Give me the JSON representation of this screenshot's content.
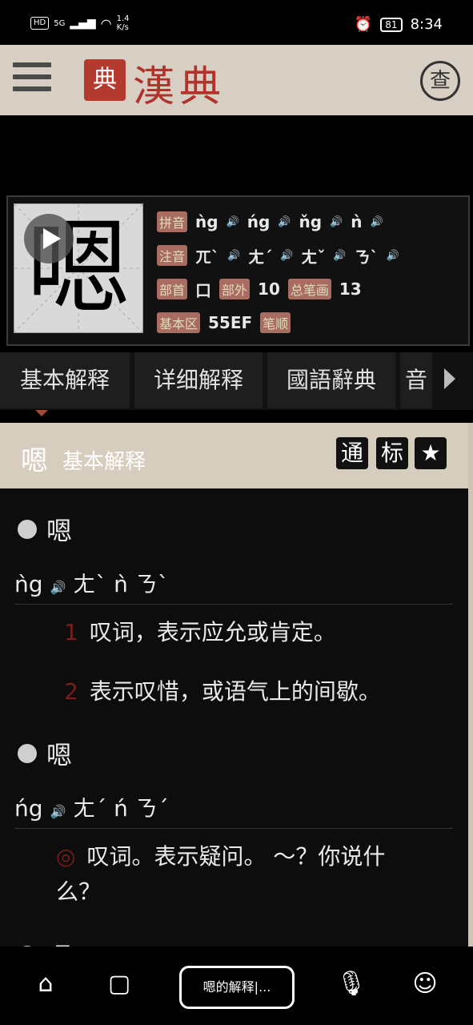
{
  "status": {
    "hd": "HD",
    "net": "5G",
    "speed_value": "1.4",
    "speed_unit": "K/s",
    "battery": "81",
    "time": "8:34"
  },
  "app": {
    "logo_seal": "典",
    "title": "漢典",
    "search_label": "查"
  },
  "card": {
    "character": "嗯",
    "pinyin_tag": "拼音",
    "pinyin": [
      "ǹg",
      "ńg",
      "ňg",
      "ǹ"
    ],
    "zhuyin_tag": "注音",
    "zhuyin": [
      "ㄫˋ",
      "ㄤˊ",
      "ㄤˇ",
      "ㄋˋ"
    ],
    "bushou_tag": "部首",
    "bushou": "口",
    "bushou_extra_tag": "部外",
    "bushou_extra": "10",
    "stroke_tag": "总笔画",
    "stroke": "13",
    "unicode_tag": "基本区",
    "unicode": "55EF",
    "order_tag": "笔顺"
  },
  "tabs": [
    "基本解释",
    "详细解释",
    "國語辭典",
    "音"
  ],
  "panel": {
    "head_char": "嗯",
    "head_title": "基本解释",
    "btn_tong": "通",
    "btn_biao": "标",
    "sections": [
      {
        "char": "嗯",
        "pinyin": "ǹg",
        "zhuyin": "ㄤˋ ǹ ㄋˋ",
        "defs": [
          {
            "num": "1",
            "text": "叹词，表示应允或肯定。"
          },
          {
            "num": "2",
            "text": "表示叹惜，或语气上的间歇。"
          }
        ]
      },
      {
        "char": "嗯",
        "pinyin": "ńg",
        "zhuyin": "ㄤˊ ń ㄋˊ",
        "defs": [
          {
            "num": "◎",
            "text": "叹词。表示疑问。 ～？你说什么？"
          }
        ]
      }
    ],
    "third_char": "嗯"
  },
  "nav": {
    "address": "嗯的解释|..."
  }
}
